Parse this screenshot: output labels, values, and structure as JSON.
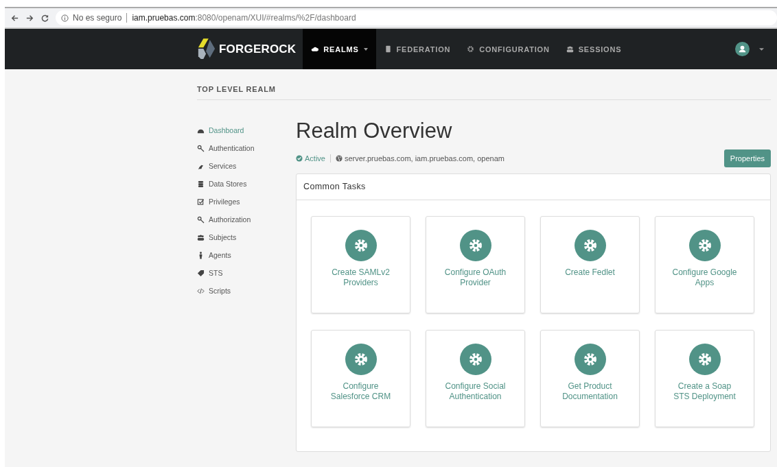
{
  "browser": {
    "security_label": "No es seguro",
    "url_host": "iam.pruebas.com",
    "url_path": ":8080/openam/XUI/#realms/%2F/dashboard"
  },
  "nav": {
    "brand": "FORGEROCK",
    "items": [
      {
        "label": "REALMS",
        "selected": true,
        "dropdown": true
      },
      {
        "label": "FEDERATION",
        "selected": false,
        "dropdown": false
      },
      {
        "label": "CONFIGURATION",
        "selected": false,
        "dropdown": false
      },
      {
        "label": "SESSIONS",
        "selected": false,
        "dropdown": false
      }
    ]
  },
  "breadcrumb": "TOP LEVEL REALM",
  "sidebar": {
    "items": [
      {
        "label": "Dashboard",
        "selected": true
      },
      {
        "label": "Authentication",
        "selected": false
      },
      {
        "label": "Services",
        "selected": false
      },
      {
        "label": "Data Stores",
        "selected": false
      },
      {
        "label": "Privileges",
        "selected": false
      },
      {
        "label": "Authorization",
        "selected": false
      },
      {
        "label": "Subjects",
        "selected": false
      },
      {
        "label": "Agents",
        "selected": false
      },
      {
        "label": "STS",
        "selected": false
      },
      {
        "label": "Scripts",
        "selected": false
      }
    ]
  },
  "page": {
    "title": "Realm Overview",
    "status": "Active",
    "aliases": "server.pruebas.com, iam.pruebas.com, openam",
    "button": "Properties"
  },
  "common_tasks": {
    "title": "Common Tasks",
    "tasks": [
      {
        "label": "Create SAMLv2 Providers"
      },
      {
        "label": "Configure OAuth Provider"
      },
      {
        "label": "Create Fedlet"
      },
      {
        "label": "Configure Google Apps"
      },
      {
        "label": "Configure Salesforce CRM"
      },
      {
        "label": "Configure Social Authentication"
      },
      {
        "label": "Get Product Documentation"
      },
      {
        "label": "Create a Soap STS Deployment"
      }
    ]
  }
}
